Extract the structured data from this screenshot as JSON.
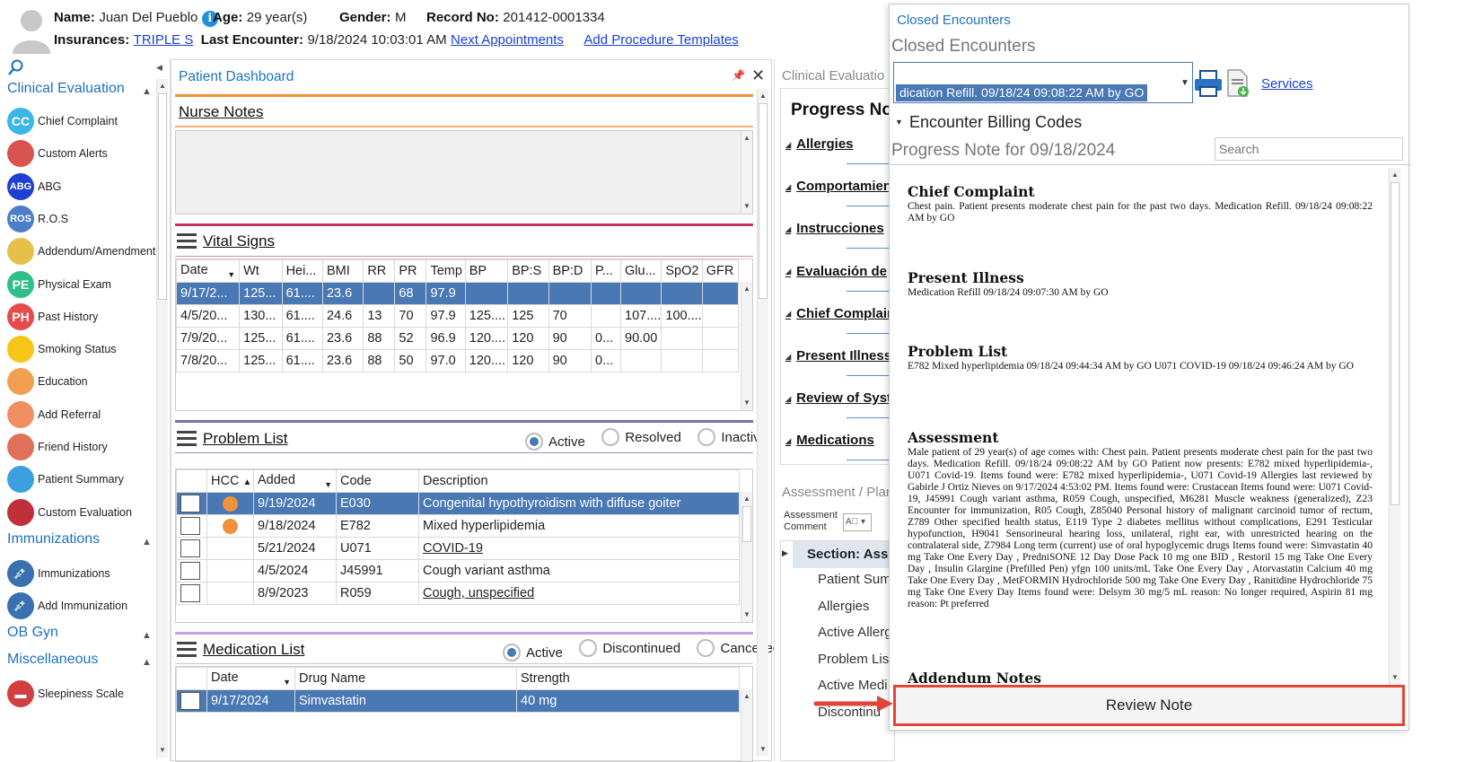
{
  "header": {
    "name_label": "Name:",
    "name": "Juan Del Pueblo",
    "age_label": "Age:",
    "age": "29 year(s)",
    "gender_label": "Gender:",
    "gender": "M",
    "record_label": "Record No:",
    "record": "201412-0001334",
    "insurances_label": "Insurances:",
    "insurance": "TRIPLE S",
    "last_encounter_label": "Last Encounter:",
    "last_encounter": "9/18/2024 10:03:01 AM",
    "next_appointments": "Next Appointments",
    "add_procedure_templates": "Add Procedure Templates"
  },
  "sidebar": {
    "sections": [
      {
        "title": "Clinical Evaluation"
      },
      {
        "title": "Immunizations"
      },
      {
        "title": "OB Gyn"
      },
      {
        "title": "Miscellaneous"
      }
    ],
    "clinical_items": [
      {
        "label": "Chief Complaint",
        "abbr": "CC",
        "color": "#3bb7e6"
      },
      {
        "label": "Custom Alerts",
        "abbr": "",
        "color": "#d9534f"
      },
      {
        "label": "ABG",
        "abbr": "ABG",
        "color": "#1f3fd1"
      },
      {
        "label": "R.O.S",
        "abbr": "ROS",
        "color": "#4a7fc7"
      },
      {
        "label": "Addendum/Amendments",
        "abbr": "",
        "color": "#e6c04a"
      },
      {
        "label": "Physical Exam",
        "abbr": "PE",
        "color": "#2fbf8a"
      },
      {
        "label": "Past History",
        "abbr": "PH",
        "color": "#e64a4a"
      },
      {
        "label": "Smoking Status",
        "abbr": "",
        "color": "#f5c518"
      },
      {
        "label": "Education",
        "abbr": "",
        "color": "#f0a050"
      },
      {
        "label": "Add Referral",
        "abbr": "",
        "color": "#f09060"
      },
      {
        "label": "Friend History",
        "abbr": "",
        "color": "#e0705a"
      },
      {
        "label": "Patient Summary",
        "abbr": "",
        "color": "#3aa0e0"
      },
      {
        "label": "Custom Evaluation",
        "abbr": "",
        "color": "#c0303a"
      }
    ],
    "immunization_items": [
      {
        "label": "Immunizations",
        "color": "#3a6fb0"
      },
      {
        "label": "Add Immunization",
        "color": "#3a6fb0"
      }
    ],
    "misc_items": [
      {
        "label": "Sleepiness Scale",
        "color": "#d04040"
      }
    ]
  },
  "dashboard": {
    "title": "Patient Dashboard",
    "nurse_notes_title": "Nurse Notes",
    "vital_signs_title": "Vital Signs",
    "vitals_columns": [
      "Date",
      "Wt",
      "Hei...",
      "BMI",
      "RR",
      "PR",
      "Temp",
      "BP",
      "BP:S",
      "BP:D",
      "P...",
      "Glu...",
      "SpO2",
      "GFR"
    ],
    "vitals_rows": [
      [
        "9/17/2...",
        "125...",
        "61....",
        "23.6",
        "",
        "68",
        "97.9",
        "",
        "",
        "",
        "",
        "",
        "",
        ""
      ],
      [
        "4/5/20...",
        "130...",
        "61....",
        "24.6",
        "13",
        "70",
        "97.9",
        "125....",
        "125",
        "70",
        "",
        "107....",
        "100....",
        ""
      ],
      [
        "7/9/20...",
        "125...",
        "61....",
        "23.6",
        "88",
        "52",
        "96.9",
        "120....",
        "120",
        "90",
        "0...",
        "90.00",
        "",
        ""
      ],
      [
        "7/8/20...",
        "125...",
        "61....",
        "23.6",
        "88",
        "50",
        "97.0",
        "120....",
        "120",
        "90",
        "0...",
        "",
        "",
        ""
      ]
    ],
    "problem_list_title": "Problem List",
    "problem_filters": [
      "Active",
      "Resolved",
      "Inactive"
    ],
    "problem_columns": [
      "HCC",
      "Added",
      "Code",
      "Description"
    ],
    "problem_rows": [
      {
        "hcc": true,
        "added": "9/19/2024",
        "code": "E030",
        "desc": "Congenital hypothyroidism with diffuse goiter",
        "link": false
      },
      {
        "hcc": true,
        "added": "9/18/2024",
        "code": "E782",
        "desc": "Mixed hyperlipidemia",
        "link": false
      },
      {
        "hcc": false,
        "added": "5/21/2024",
        "code": "U071",
        "desc": "COVID-19",
        "link": true
      },
      {
        "hcc": false,
        "added": "4/5/2024",
        "code": "J45991",
        "desc": "Cough variant asthma",
        "link": false
      },
      {
        "hcc": false,
        "added": "8/9/2023",
        "code": "R059",
        "desc": "Cough, unspecified",
        "link": true
      }
    ],
    "medication_list_title": "Medication List",
    "med_filters": [
      "Active",
      "Discontinued",
      "Cancelled"
    ],
    "med_columns": [
      "Date",
      "Drug Name",
      "Strength"
    ],
    "med_rows": [
      {
        "date": "9/17/2024",
        "drug": "Simvastatin",
        "strength": "40 mg"
      }
    ]
  },
  "clinical": {
    "title": "Clinical Evaluatio",
    "progress_title": "Progress Not",
    "items": [
      "Allergies",
      "Comportamien",
      "Instrucciones",
      "Evaluación de",
      "Chief Complair",
      "Present Illness",
      "Review of Syst",
      "Medications"
    ],
    "assessment_title": "Assessment / Plan",
    "assessment_comment": "Assessment Comment",
    "section_label": "Section: Ass",
    "sub_items": [
      "Patient Sum",
      "Allergies",
      "Active Allerg",
      "Problem Lis",
      "Active Medi",
      "Discontinu"
    ]
  },
  "closed": {
    "title": "Closed Encounters",
    "subtitle": "Closed Encounters",
    "selected_encounter": "dication Refill.    09/18/24 09:08:22 AM by GO",
    "services": "Services",
    "billing_codes": "Encounter Billing Codes",
    "progress_note_for": "Progress Note for 09/18/2024",
    "search_placeholder": "Search",
    "notes": [
      {
        "heading": "Chief Complaint",
        "body": "Chest pain. Patient presents moderate chest pain for the past two days. Medication Refill. 09/18/24 09:08:22 AM by GO"
      },
      {
        "heading": "Present Illness",
        "body": "Medication Refill 09/18/24 09:07:30 AM by GO"
      },
      {
        "heading": "Problem List",
        "body": "E782 Mixed hyperlipidemia 09/18/24 09:44:34 AM by GO U071 COVID-19 09/18/24 09:46:24 AM by GO"
      },
      {
        "heading": "Assessment",
        "body": "Male patient of 29 year(s) of age comes with: Chest pain. Patient presents moderate chest pain for the past two days. Medication Refill. 09/18/24 09:08:22 AM by GO Patient now presents: E782 mixed hyperlipidemia-, U071 Covid-19. Items found were: E782 mixed hyperlipidemia-, U071 Covid-19 Allergies last reviewed by Gabirle J Ortiz Nieves on 9/17/2024 4:53:02 PM. Items found were: Crustacean Items found were: U071 Covid-19, J45991 Cough variant asthma, R059 Cough, unspecified, M6281 Muscle weakness (generalized), Z23 Encounter for immunization, R05 Cough, Z85040 Personal history of malignant carcinoid tumor of rectum, Z789 Other specified health status, E119 Type 2 diabetes mellitus without complications, E291 Testicular hypofunction, H9041 Sensorineural hearing loss, unilateral, right ear, with unrestricted hearing on the contralateral side, Z7984 Long term (current) use of oral hypoglycemic drugs Items found were: Simvastatin 40 mg Take One Every Day , PredniSONE 12 Day Dose Pack 10 mg one BID , Restoril 15 mg Take One Every Day , Insulin Glargine (Prefilled Pen) yfgn 100 units/mL Take One Every Day , Atorvastatin Calcium 40 mg Take One Every Day , MetFORMIN Hydrochloride 500 mg Take One Every Day , Ranitidine Hydrochloride 75 mg Take One Every Day Items found were: Delsym 30 mg/5 mL reason: No longer required, Aspirin 81 mg reason: Pt preferred"
      },
      {
        "heading": "Addendum Notes",
        "body": ""
      }
    ],
    "review_note": "Review Note"
  }
}
